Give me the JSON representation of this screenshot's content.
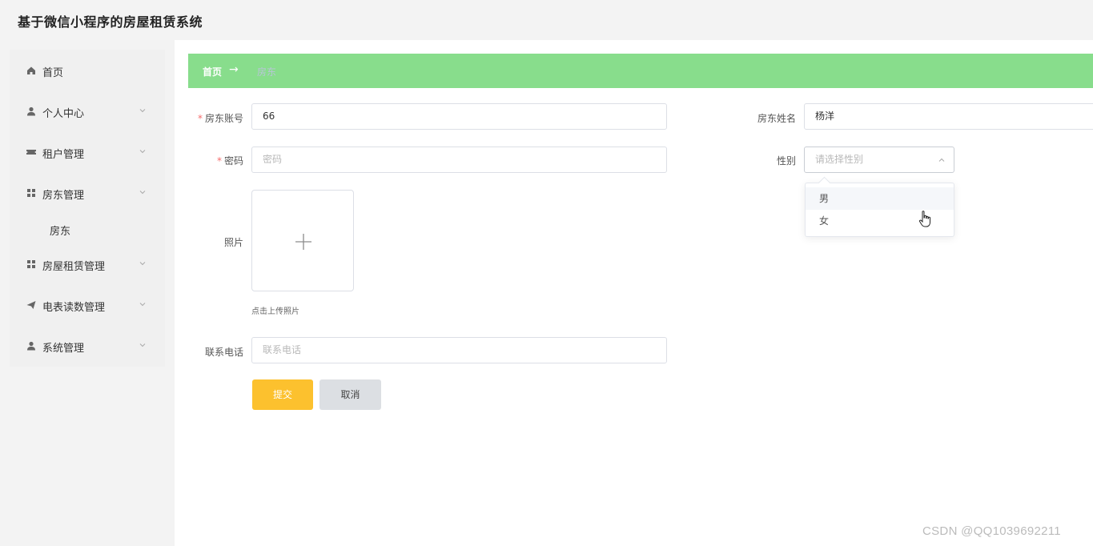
{
  "app": {
    "title": "基于微信小程序的房屋租赁系统"
  },
  "sidebar": {
    "items": [
      {
        "label": "首页",
        "icon": "home-icon",
        "has_arrow": false
      },
      {
        "label": "个人中心",
        "icon": "user-icon",
        "has_arrow": true
      },
      {
        "label": "租户管理",
        "icon": "ticket-icon",
        "has_arrow": true
      },
      {
        "label": "房东管理",
        "icon": "grid-icon",
        "has_arrow": true,
        "expanded": true,
        "children": [
          {
            "label": "房东"
          }
        ]
      },
      {
        "label": "房屋租赁管理",
        "icon": "grid-icon",
        "has_arrow": true
      },
      {
        "label": "电表读数管理",
        "icon": "send-icon",
        "has_arrow": true
      },
      {
        "label": "系统管理",
        "icon": "user-icon",
        "has_arrow": true
      }
    ]
  },
  "breadcrumb": {
    "home": "首页",
    "separator": "→",
    "current": "房东"
  },
  "form": {
    "account": {
      "label": "房东账号",
      "required": true,
      "value": "66"
    },
    "name": {
      "label": "房东姓名",
      "required": false,
      "value": "杨洋"
    },
    "password": {
      "label": "密码",
      "required": true,
      "value": "",
      "placeholder": "密码"
    },
    "gender": {
      "label": "性别",
      "value": "",
      "placeholder": "请选择性别",
      "options": [
        "男",
        "女"
      ],
      "open": true,
      "hovered_option": "男"
    },
    "photo": {
      "label": "照片",
      "hint": "点击上传照片"
    },
    "phone": {
      "label": "联系电话",
      "value": "",
      "placeholder": "联系电话"
    },
    "submit_label": "提交",
    "cancel_label": "取消"
  },
  "colors": {
    "breadcrumb_bg": "#88dd8c",
    "submit_bg": "#fcc12e",
    "cancel_bg": "#dcdfe3",
    "required_star": "#f56c6c"
  },
  "watermark": "CSDN @QQ1039692211"
}
